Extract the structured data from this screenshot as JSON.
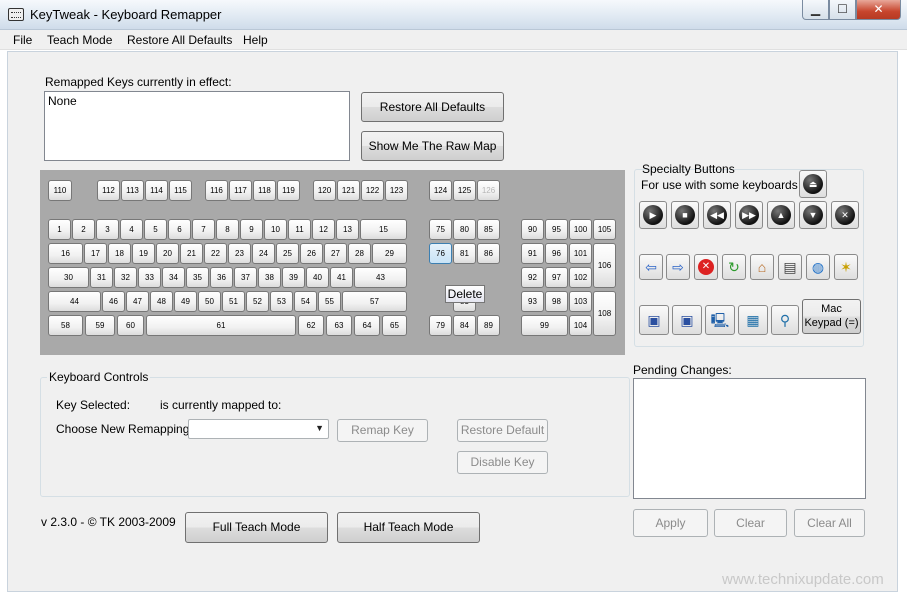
{
  "window": {
    "title": "KeyTweak -  Keyboard Remapper",
    "min": "▁",
    "max": "☐",
    "close": "✕"
  },
  "menu": [
    "File",
    "Teach Mode",
    "Restore All Defaults",
    "Help"
  ],
  "remapped": {
    "label": "Remapped Keys currently in effect:",
    "value": "None"
  },
  "buttons": {
    "restore_all": "Restore All Defaults",
    "raw_map": "Show Me The Raw Map",
    "remap_key": "Remap Key",
    "restore_default": "Restore Default",
    "disable_key": "Disable Key",
    "full_teach": "Full Teach Mode",
    "half_teach": "Half Teach Mode",
    "apply": "Apply",
    "clear": "Clear",
    "clear_all": "Clear All"
  },
  "keyboard": {
    "keys": [
      "110",
      "112",
      "113",
      "114",
      "115",
      "116",
      "117",
      "118",
      "119",
      "120",
      "121",
      "122",
      "123",
      "124",
      "125",
      "126",
      "1",
      "2",
      "3",
      "4",
      "5",
      "6",
      "7",
      "8",
      "9",
      "10",
      "11",
      "12",
      "13",
      "15",
      "16",
      "17",
      "18",
      "19",
      "20",
      "21",
      "22",
      "23",
      "24",
      "25",
      "26",
      "27",
      "28",
      "29",
      "30",
      "31",
      "32",
      "33",
      "34",
      "35",
      "36",
      "37",
      "38",
      "39",
      "40",
      "41",
      "43",
      "44",
      "46",
      "47",
      "48",
      "49",
      "50",
      "51",
      "52",
      "53",
      "54",
      "55",
      "57",
      "58",
      "59",
      "60",
      "61",
      "62",
      "63",
      "64",
      "65",
      "75",
      "80",
      "85",
      "76",
      "81",
      "86",
      "83",
      "79",
      "84",
      "89",
      "90",
      "95",
      "100",
      "105",
      "91",
      "96",
      "101",
      "106",
      "92",
      "97",
      "102",
      "93",
      "98",
      "103",
      "108",
      "99",
      "104"
    ],
    "tooltip": "Delete"
  },
  "controls": {
    "title": "Keyboard Controls",
    "key_selected": "Key Selected:",
    "mapped_to": "is currently mapped to:",
    "choose": "Choose New Remapping"
  },
  "specialty": {
    "title": "Specialty Buttons",
    "subtitle": "For use with some keyboards",
    "mac_keypad": "Mac Keypad (=)",
    "icons": [
      "eject-icon",
      "play-icon",
      "stop-icon",
      "rewind-icon",
      "fast-forward-icon",
      "eject-up-icon",
      "volume-down-icon",
      "mute-icon",
      "back-arrow-icon",
      "forward-arrow-icon",
      "browser-stop-icon",
      "refresh-icon",
      "home-icon",
      "search-doc-icon",
      "web-globe-icon",
      "favorites-icon",
      "my-computer-icon",
      "email-icon",
      "computer-icon",
      "calculator-icon",
      "search-icon"
    ]
  },
  "pending": {
    "label": "Pending Changes:"
  },
  "footer": {
    "version": "v 2.3.0 - © TK 2003-2009"
  },
  "watermark": "www.technixupdate.com"
}
